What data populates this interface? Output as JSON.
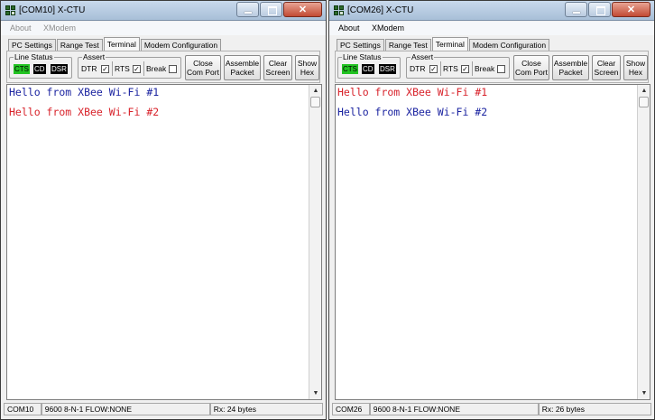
{
  "windows": [
    {
      "title": "[COM10] X-CTU",
      "menu": [
        "About",
        "XModem"
      ],
      "tabs": [
        "PC Settings",
        "Range Test",
        "Terminal",
        "Modem Configuration"
      ],
      "active_tab": "Terminal",
      "line_status": {
        "title": "Line Status",
        "leds": [
          {
            "label": "CTS",
            "on": true
          },
          {
            "label": "CD",
            "on": false
          },
          {
            "label": "DSR",
            "on": false
          }
        ]
      },
      "assert": {
        "title": "Assert",
        "dtr": "DTR",
        "rts": "RTS",
        "brk": "Break",
        "check": "✓"
      },
      "buttons": {
        "close_port": "Close\nCom Port",
        "assemble": "Assemble\nPacket",
        "clear": "Clear\nScreen",
        "show_hex": "Show\nHex"
      },
      "terminal_lines": [
        {
          "text": "Hello from XBee Wi-Fi #1",
          "color": "#1a23a0"
        },
        {
          "text": "Hello from XBee Wi-Fi #2",
          "color": "#d8222a"
        }
      ],
      "status": {
        "port": "COM10",
        "settings": "9600 8-N-1  FLOW:NONE",
        "rx": "Rx: 24 bytes"
      }
    },
    {
      "title": "[COM26] X-CTU",
      "menu": [
        "About",
        "XModem"
      ],
      "tabs": [
        "PC Settings",
        "Range Test",
        "Terminal",
        "Modem Configuration"
      ],
      "active_tab": "Terminal",
      "line_status": {
        "title": "Line Status",
        "leds": [
          {
            "label": "CTS",
            "on": true
          },
          {
            "label": "CD",
            "on": false
          },
          {
            "label": "DSR",
            "on": false
          }
        ]
      },
      "assert": {
        "title": "Assert",
        "dtr": "DTR",
        "rts": "RTS",
        "brk": "Break",
        "check": "✓"
      },
      "buttons": {
        "close_port": "Close\nCom Port",
        "assemble": "Assemble\nPacket",
        "clear": "Clear\nScreen",
        "show_hex": "Show\nHex"
      },
      "terminal_lines": [
        {
          "text": "Hello from XBee Wi-Fi #1",
          "color": "#d8222a"
        },
        {
          "text": "Hello from XBee Wi-Fi #2",
          "color": "#1a23a0"
        }
      ],
      "status": {
        "port": "COM26",
        "settings": "9600 8-N-1  FLOW:NONE",
        "rx": "Rx: 26 bytes"
      }
    }
  ],
  "caption_buttons": {
    "close": "✕"
  },
  "scroll": {
    "up": "▲",
    "down": "▼"
  }
}
